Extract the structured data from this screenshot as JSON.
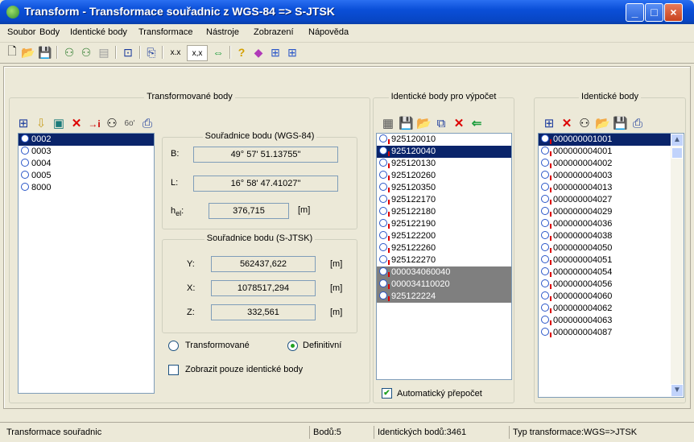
{
  "window": {
    "title": "Transform - Transformace souřadnic z WGS-84 => S-JTSK"
  },
  "menu": [
    "Soubor",
    "Body",
    "Identické body",
    "Transformace",
    "Nástroje",
    "Zobrazení",
    "Nápověda"
  ],
  "toolbar": {
    "text_buttons": [
      "x.x",
      "x,x"
    ]
  },
  "left_panel": {
    "title": "Transformované body",
    "points": [
      "0002",
      "0003",
      "0004",
      "0005",
      "8000"
    ],
    "selected": "0002",
    "wgs_group": "Souřadnice bodu (WGS-84)",
    "B_label": "B:",
    "B_value": "49°  57'  51.13755\"",
    "L_label": "L:",
    "L_value": "16°  58'  47.41027\"",
    "h_label": "h",
    "h_sub": "el",
    "h_colon": ":",
    "h_value": "376,715",
    "h_unit": "[m]",
    "sjtsk_group": "Souřadnice bodu (S-JTSK)",
    "Y_label": "Y:",
    "Y_value": "562437,622",
    "Y_unit": "[m]",
    "X_label": "X:",
    "X_value": "1078517,294",
    "X_unit": "[m]",
    "Z_label": "Z:",
    "Z_value": "332,561",
    "Z_unit": "[m]",
    "radio_transformed": "Transformované",
    "radio_definitive": "Definitivní",
    "radio_selected": "Definitivní",
    "checkbox_identical_only": "Zobrazit pouze identické body",
    "checkbox_checked": false
  },
  "middle_panel": {
    "title": "Identické body pro výpočet",
    "items": [
      "925120010",
      "925120040",
      "925120130",
      "925120260",
      "925120350",
      "925122170",
      "925122180",
      "925122190",
      "925122200",
      "925122260",
      "925122270",
      "000034060040",
      "000034110020",
      "925122224"
    ],
    "selected": "925120040",
    "grayed": [
      "000034060040",
      "000034110020",
      "925122224"
    ],
    "auto_recalc": "Automatický přepočet",
    "auto_recalc_checked": true
  },
  "right_panel": {
    "title": "Identické body",
    "items": [
      "000000001001",
      "000000004001",
      "000000004002",
      "000000004003",
      "000000004013",
      "000000004027",
      "000000004029",
      "000000004036",
      "000000004038",
      "000000004050",
      "000000004051",
      "000000004054",
      "000000004056",
      "000000004060",
      "000000004062",
      "000000004063",
      "000000004087"
    ],
    "selected": "000000001001"
  },
  "status": {
    "app": "Transformace souřadnic",
    "count": "Bodů:5",
    "identical": "Identických bodů:3461",
    "type": "Typ transformace:WGS=>JTSK"
  }
}
